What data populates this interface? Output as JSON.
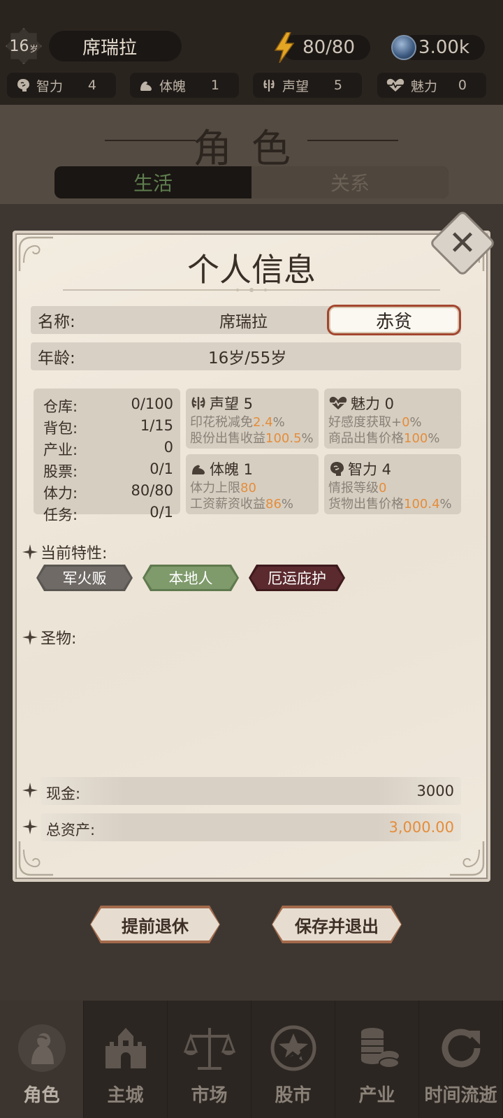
{
  "header": {
    "age": "16",
    "age_unit": "岁",
    "player_name": "席瑞拉",
    "energy": "80/80",
    "currency": "3.00k",
    "stats": [
      {
        "label": "智力",
        "value": "4",
        "icon": "brain-icon"
      },
      {
        "label": "体魄",
        "value": "1",
        "icon": "arm-icon"
      },
      {
        "label": "声望",
        "value": "5",
        "icon": "laurel-icon"
      },
      {
        "label": "魅力",
        "value": "0",
        "icon": "heart-icon"
      }
    ]
  },
  "page": {
    "title": "角色",
    "tabs": [
      {
        "label": "生活",
        "active": true
      },
      {
        "label": "关系",
        "active": false
      }
    ]
  },
  "modal": {
    "title": "个人信息",
    "name_label": "名称:",
    "name_value": "席瑞拉",
    "status_badge": "赤贫",
    "age_label": "年龄:",
    "age_value": "16岁/55岁",
    "inventory": [
      {
        "label": "仓库:",
        "value": "0/100"
      },
      {
        "label": "背包:",
        "value": "1/15"
      },
      {
        "label": "产业:",
        "value": "0"
      },
      {
        "label": "股票:",
        "value": "0/1"
      },
      {
        "label": "体力:",
        "value": "80/80"
      },
      {
        "label": "任务:",
        "value": "0/1"
      }
    ],
    "attributes": {
      "reputation": {
        "title": "声望 5",
        "line1_label": "印花税减免",
        "line1_value": "2.4",
        "line1_unit": "%",
        "line2_label": "股份出售收益",
        "line2_value": "100.5",
        "line2_unit": "%"
      },
      "charm": {
        "title": "魅力 0",
        "line1_label": "好感度获取+",
        "line1_value": "0",
        "line1_unit": "%",
        "line2_label": "商品出售价格",
        "line2_value": "100",
        "line2_unit": "%"
      },
      "physique": {
        "title": "体魄 1",
        "line1_label": "体力上限",
        "line1_value": "80",
        "line1_unit": "",
        "line2_label": "工资薪资收益",
        "line2_value": "86",
        "line2_unit": "%"
      },
      "intelligence": {
        "title": "智力 4",
        "line1_label": "情报等级",
        "line1_value": "0",
        "line1_unit": "",
        "line2_label": "货物出售价格",
        "line2_value": "100.4",
        "line2_unit": "%"
      }
    },
    "traits_label": "当前特性:",
    "traits": [
      {
        "label": "军火贩",
        "color": "#6f6a66"
      },
      {
        "label": "本地人",
        "color": "#7f9a6b"
      },
      {
        "label": "厄运庇护",
        "color": "#5b2a2e"
      }
    ],
    "relics_label": "圣物:",
    "cash_label": "现金:",
    "cash_value": "3000",
    "assets_label": "总资产:",
    "assets_value": "3,000.00",
    "accent_orange": "#e48d3b"
  },
  "actions": {
    "retire": "提前退休",
    "save_exit": "保存并退出"
  },
  "nav": [
    {
      "label": "角色",
      "icon": "character-icon",
      "active": true
    },
    {
      "label": "主城",
      "icon": "castle-icon",
      "active": false
    },
    {
      "label": "市场",
      "icon": "scales-icon",
      "active": false
    },
    {
      "label": "股市",
      "icon": "stock-icon",
      "active": false
    },
    {
      "label": "产业",
      "icon": "coins-icon",
      "active": false
    },
    {
      "label": "时间流逝",
      "icon": "refresh-icon",
      "active": false
    }
  ]
}
